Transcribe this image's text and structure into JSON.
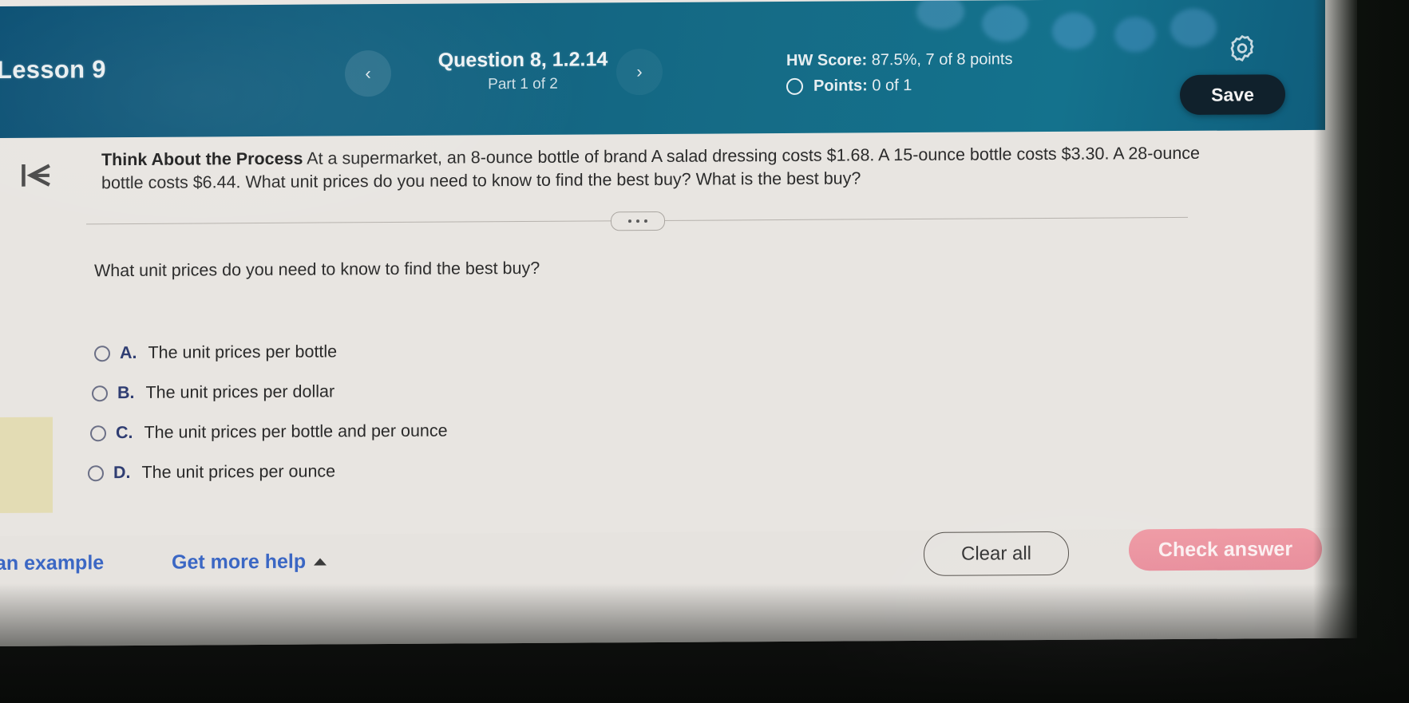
{
  "header": {
    "lesson_title": "Lesson 9",
    "prev_label": "‹",
    "next_label": "›",
    "question_number": "Question 8, 1.2.14",
    "question_part": "Part 1 of 2",
    "hw_score_label": "HW Score:",
    "hw_score_value": "87.5%, 7 of 8 points",
    "points_label": "Points:",
    "points_value": "0 of 1",
    "save_label": "Save",
    "accent_color": "#14728d",
    "save_bg": "#10212c"
  },
  "prompt": {
    "bold_lead": "Think About the Process",
    "body": " At a supermarket, an 8-ounce bottle of brand A salad dressing costs $1.68. A 15-ounce bottle costs $3.30. A 28-ounce bottle costs $6.44. What unit prices do you need to know to find the best buy? What is the best buy?"
  },
  "question": {
    "sub_question": "What unit prices do you need to know to find the best buy?",
    "options": [
      {
        "letter": "A.",
        "text": "The unit prices per bottle"
      },
      {
        "letter": "B.",
        "text": "The unit prices per dollar"
      },
      {
        "letter": "C.",
        "text": "The unit prices per bottle and per ounce"
      },
      {
        "letter": "D.",
        "text": "The unit prices per ounce"
      }
    ]
  },
  "footer": {
    "view_example_label": "an example",
    "get_more_help_label": "Get more help",
    "clear_all_label": "Clear all",
    "check_answer_label": "Check answer",
    "link_color": "#3b67c4",
    "check_answer_color": "#e88e9c"
  }
}
